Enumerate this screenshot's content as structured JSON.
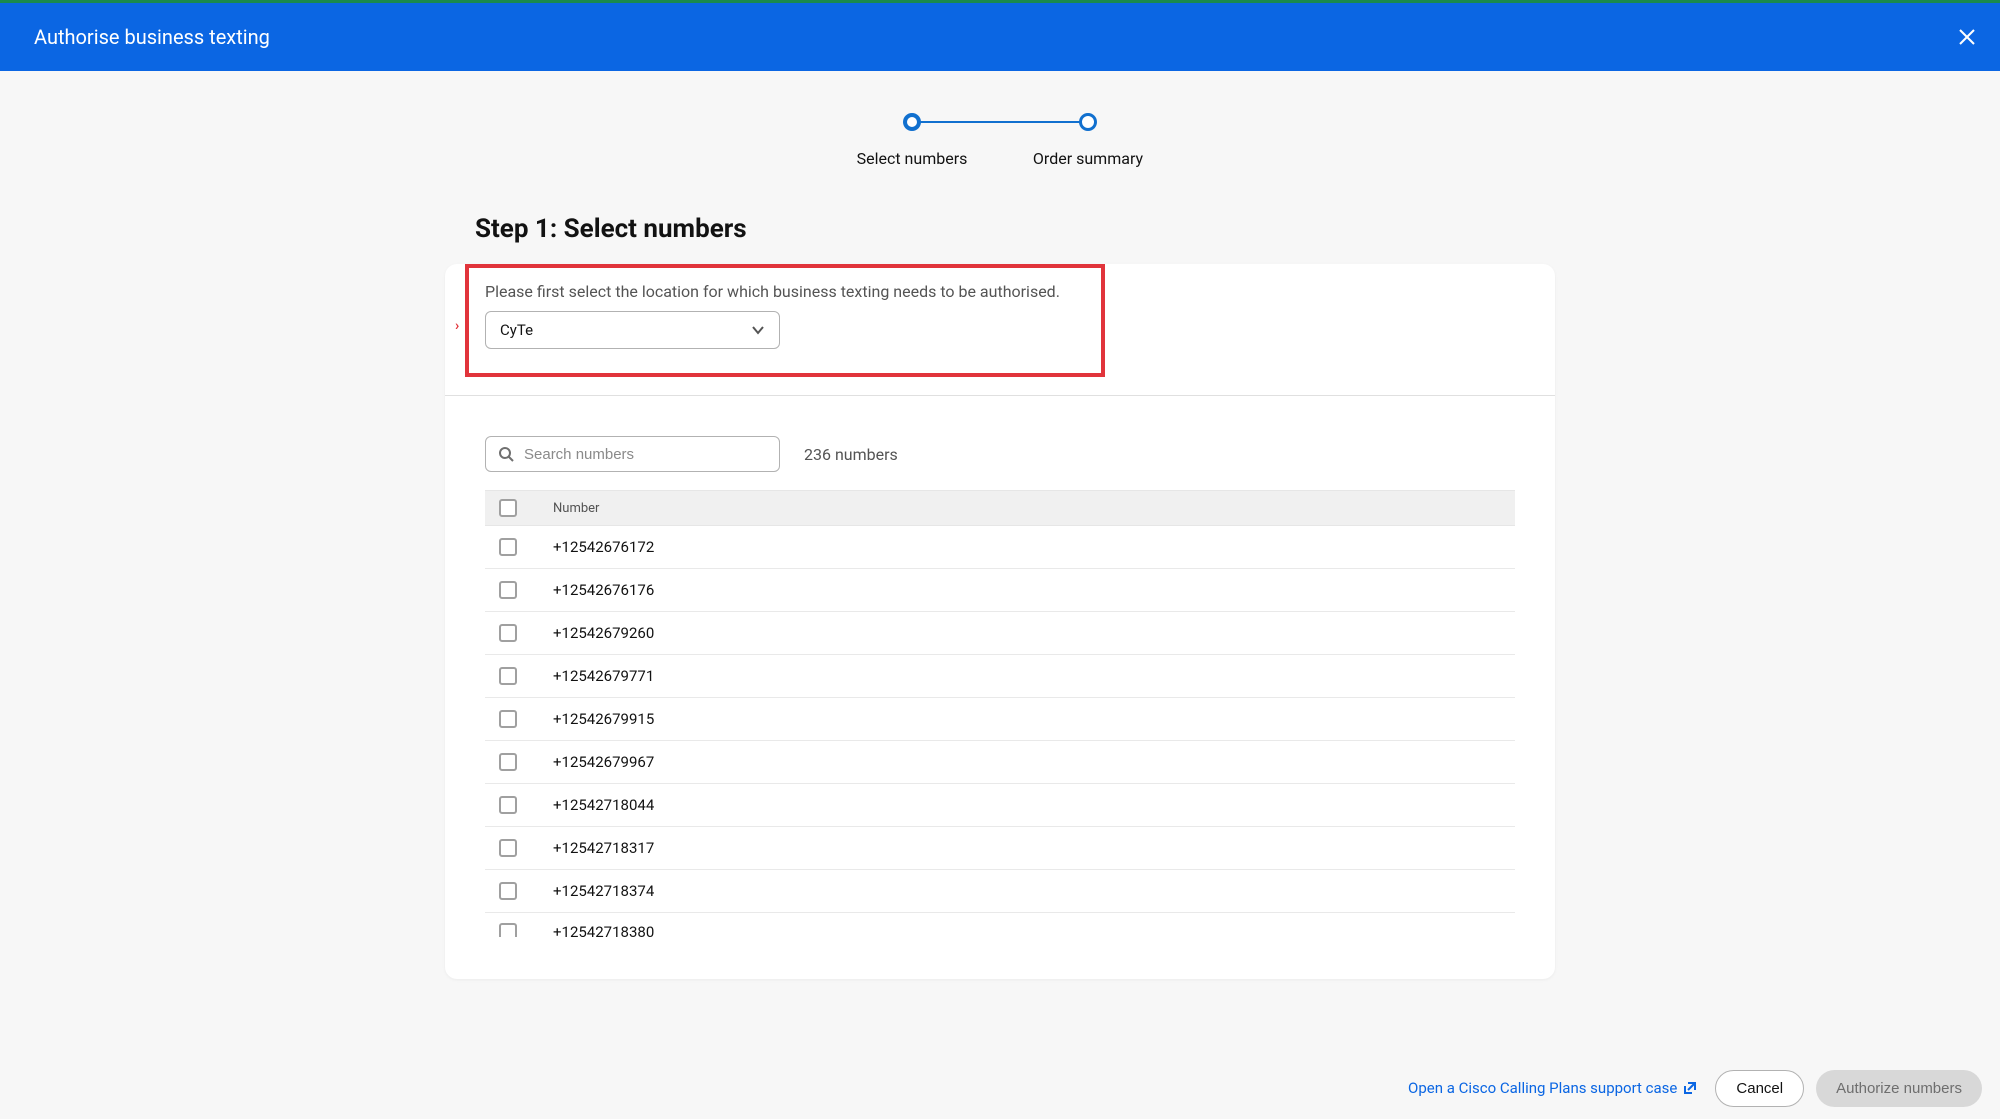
{
  "header": {
    "title": "Authorise business texting"
  },
  "stepper": {
    "step1": "Select numbers",
    "step2": "Order summary"
  },
  "page": {
    "title": "Step 1: Select numbers"
  },
  "location": {
    "instruction": "Please first select the location for which business texting needs to be authorised.",
    "selected": "CyTe"
  },
  "search": {
    "placeholder": "Search numbers"
  },
  "numbers": {
    "count_label": "236 numbers",
    "column_header": "Number",
    "rows": [
      "+12542676172",
      "+12542676176",
      "+12542679260",
      "+12542679771",
      "+12542679915",
      "+12542679967",
      "+12542718044",
      "+12542718317",
      "+12542718374",
      "+12542718380"
    ]
  },
  "footer": {
    "support_link": "Open a Cisco Calling Plans support case",
    "cancel": "Cancel",
    "authorize": "Authorize numbers"
  }
}
